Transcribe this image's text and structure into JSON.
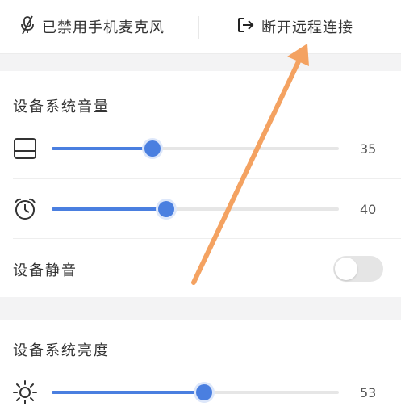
{
  "topbar": {
    "mic_label": "已禁用手机麦克风",
    "mic_icon": "mic-off-icon",
    "disconnect_label": "断开远程连接",
    "disconnect_icon": "logout-icon"
  },
  "volume_section": {
    "title": "设备系统音量",
    "sliders": [
      {
        "icon": "screen-icon",
        "value": 35,
        "value_label": "35"
      },
      {
        "icon": "alarm-clock-icon",
        "value": 40,
        "value_label": "40"
      }
    ],
    "mute_label": "设备静音",
    "mute_on": false
  },
  "brightness_section": {
    "title": "设备系统亮度",
    "slider": {
      "icon": "sun-icon",
      "value": 53,
      "value_label": "53"
    }
  },
  "colors": {
    "accent": "#4a7fe0",
    "annotation_arrow": "#f4a261"
  }
}
